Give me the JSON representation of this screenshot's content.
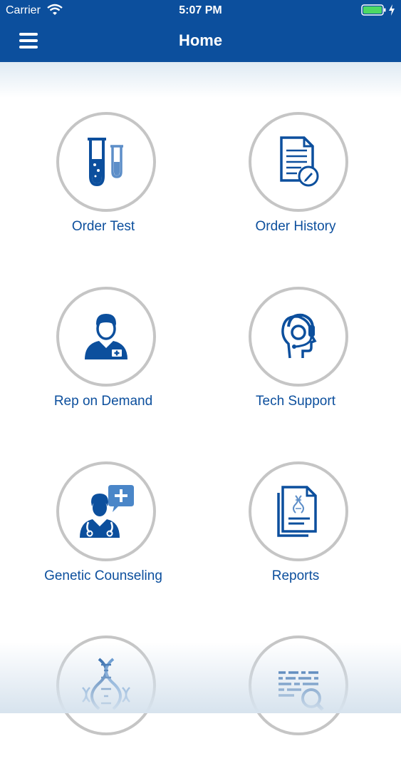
{
  "status_bar": {
    "carrier": "Carrier",
    "time": "5:07 PM"
  },
  "nav": {
    "title": "Home"
  },
  "tiles": [
    {
      "label": "Order Test",
      "icon": "test-tubes-icon"
    },
    {
      "label": "Order History",
      "icon": "document-edit-icon"
    },
    {
      "label": "Rep on Demand",
      "icon": "medical-rep-icon"
    },
    {
      "label": "Tech Support",
      "icon": "headset-icon"
    },
    {
      "label": "Genetic Counseling",
      "icon": "counselor-icon"
    },
    {
      "label": "Reports",
      "icon": "report-icon"
    },
    {
      "label": "",
      "icon": "dna-icon"
    },
    {
      "label": "",
      "icon": "data-search-icon"
    }
  ],
  "colors": {
    "brand": "#0c4f9d",
    "ring": "#c5c5c5",
    "battery": "#4cd964"
  }
}
